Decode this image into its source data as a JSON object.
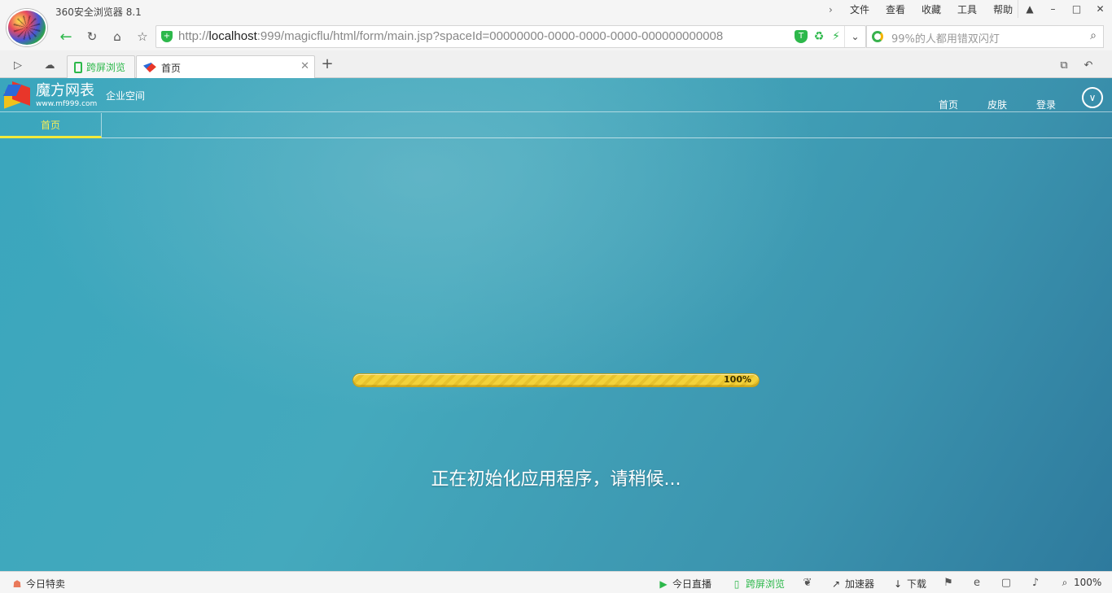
{
  "browser": {
    "title": "360安全浏览器 8.1",
    "menu": [
      "文件",
      "查看",
      "收藏",
      "工具",
      "帮助"
    ],
    "address": {
      "url_prefix": "http://",
      "url_host": "localhost",
      "url_rest": ":999/magicflu/html/form/main.jsp?spaceId=00000000-0000-0000-0000-000000000008"
    },
    "search": {
      "placeholder": "99%的人都用错双闪灯"
    },
    "tabs": [
      {
        "label": "跨屏浏览",
        "active": false
      },
      {
        "label": "首页",
        "active": true
      }
    ]
  },
  "site": {
    "name": "魔方网表",
    "url": "www.mf999.com",
    "space_label": "企业空间",
    "nav": [
      "首页",
      "皮肤",
      "登录"
    ],
    "subnav_tab": "首页"
  },
  "loading": {
    "progress_percent": 100,
    "progress_label": "100%",
    "message": "正在初始化应用程序，请稍候..."
  },
  "statusbar": {
    "left": "今日特卖",
    "live": "今日直播",
    "cross_screen": "跨屏浏览",
    "accelerator": "加速器",
    "download": "下载",
    "zoom": "100%"
  },
  "colors": {
    "content_bg": "#3aa6bd",
    "progress_fill": "#f3d23a",
    "active_subtab": "#f3ea3a",
    "accent_green": "#2db84b"
  }
}
